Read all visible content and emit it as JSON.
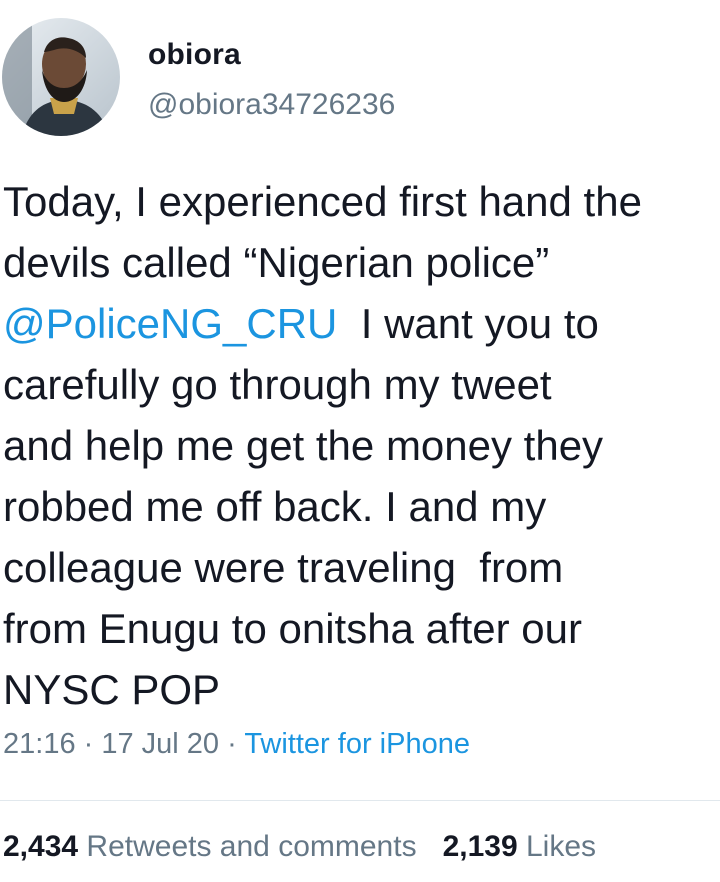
{
  "user": {
    "display_name": "obiora",
    "handle": "@obiora34726236"
  },
  "tweet": {
    "lines": [
      {
        "before": "Today, I experienced first hand the",
        "mention": "",
        "after": ""
      },
      {
        "before": "devils called “Nigerian police”",
        "mention": "",
        "after": ""
      },
      {
        "before": "",
        "mention": "@PoliceNG_CRU",
        "after": "  I want you to"
      },
      {
        "before": "carefully go through my tweet",
        "mention": "",
        "after": ""
      },
      {
        "before": "and help me get the money they",
        "mention": "",
        "after": ""
      },
      {
        "before": "robbed me off back. I and my",
        "mention": "",
        "after": ""
      },
      {
        "before": "colleague were traveling  from",
        "mention": "",
        "after": ""
      },
      {
        "before": "from Enugu to onitsha after our",
        "mention": "",
        "after": ""
      },
      {
        "before": "NYSC POP",
        "mention": "",
        "after": ""
      }
    ]
  },
  "meta": {
    "time": "21:16",
    "separator": " · ",
    "date": "17 Jul 20",
    "source": "Twitter for iPhone"
  },
  "stats": {
    "retweets_count": "2,434",
    "retweets_label": "Retweets and comments",
    "likes_count": "2,139",
    "likes_label": "Likes"
  },
  "colors": {
    "text": "#141823",
    "secondary": "#657786",
    "link": "#1b95e0",
    "divider": "#e1e8ed"
  }
}
